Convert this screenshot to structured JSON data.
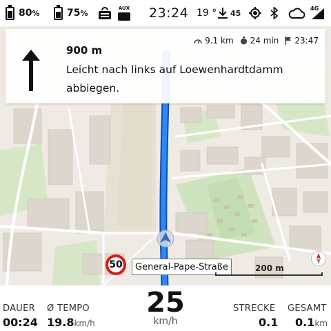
{
  "status_bar": {
    "battery1": "80",
    "battery2": "75",
    "percent_sign": "%",
    "aux_label": "AUX",
    "clock": "23:24",
    "temperature": "19 °",
    "download_count": "45",
    "network_label": "4G"
  },
  "navigation": {
    "distance": "900 m",
    "instruction": "Leicht nach links auf Loewenhardtdamm abbiegen.",
    "remaining_distance": "9.1 km",
    "remaining_time": "24 min",
    "arrival_time": "23:47"
  },
  "map": {
    "speed_limit": "50",
    "street_name": "General-Pape-Straße",
    "scale_label": "200 m",
    "route_color": "#1e6fe6"
  },
  "bottom_bar": {
    "duration_label": "DAUER",
    "duration_value": "00:24",
    "avg_speed_label": "Ø TEMPO",
    "avg_speed_value": "19.8",
    "avg_speed_unit": "km/h",
    "current_speed": "25",
    "current_speed_unit": "km/h",
    "distance_label": "STRECKE",
    "distance_value": "0.1",
    "total_label": "GESAMT",
    "total_value": "0.1",
    "total_unit": "km"
  }
}
